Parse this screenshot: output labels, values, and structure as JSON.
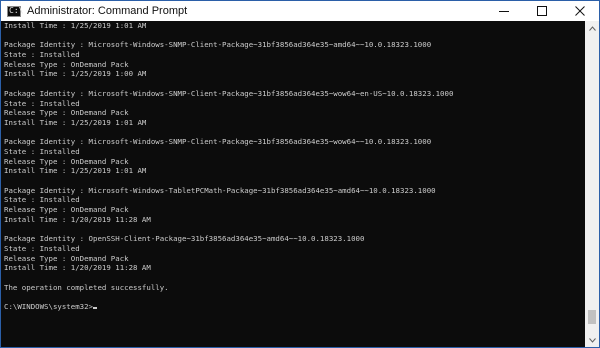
{
  "window": {
    "title": "Administrator: Command Prompt",
    "icon": "cmd-prompt-icon",
    "controls": [
      "minimize-icon",
      "maximize-icon",
      "close-icon"
    ]
  },
  "console": {
    "lines": [
      "Install Time : 1/25/2019 1:01 AM",
      "",
      "Package Identity : Microsoft-Windows-SNMP-Client-Package~31bf3856ad364e35~amd64~~10.0.18323.1000",
      "State : Installed",
      "Release Type : OnDemand Pack",
      "Install Time : 1/25/2019 1:00 AM",
      "",
      "Package Identity : Microsoft-Windows-SNMP-Client-Package~31bf3856ad364e35~wow64~en-US~10.0.18323.1000",
      "State : Installed",
      "Release Type : OnDemand Pack",
      "Install Time : 1/25/2019 1:01 AM",
      "",
      "Package Identity : Microsoft-Windows-SNMP-Client-Package~31bf3856ad364e35~wow64~~10.0.18323.1000",
      "State : Installed",
      "Release Type : OnDemand Pack",
      "Install Time : 1/25/2019 1:01 AM",
      "",
      "Package Identity : Microsoft-Windows-TabletPCMath-Package~31bf3856ad364e35~amd64~~10.0.18323.1000",
      "State : Installed",
      "Release Type : OnDemand Pack",
      "Install Time : 1/20/2019 11:28 AM",
      "",
      "Package Identity : OpenSSH-Client-Package~31bf3856ad364e35~amd64~~10.0.18323.1000",
      "State : Installed",
      "Release Type : OnDemand Pack",
      "Install Time : 1/20/2019 11:28 AM",
      "",
      "The operation completed successfully.",
      "",
      "C:\\WINDOWS\\system32>"
    ]
  },
  "scrollbar": {
    "position": 0.97,
    "visible_fraction": 0.05
  },
  "colors": {
    "console_background": "#0c0c0c",
    "console_text": "#cccccc",
    "titlebar_background": "#ffffff",
    "window_border": "#2b5fa8"
  }
}
